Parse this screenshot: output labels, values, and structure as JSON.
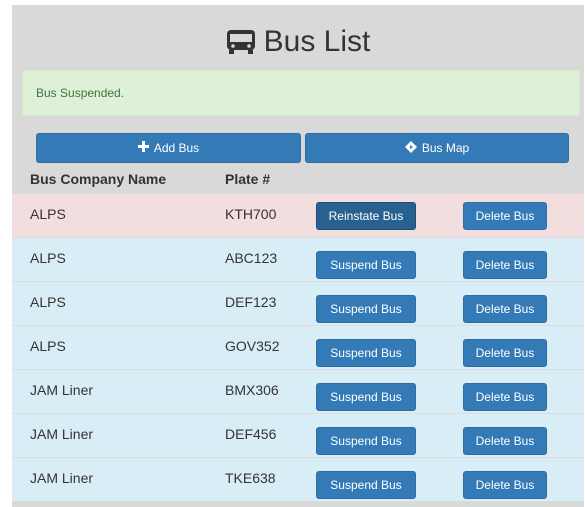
{
  "page": {
    "title": "Bus List",
    "title_icon": "bus-icon"
  },
  "alert": {
    "message": "Bus Suspended."
  },
  "toolbar": {
    "add_label": "Add Bus",
    "add_icon": "plus-icon",
    "map_label": "Bus Map",
    "map_icon": "directions-icon"
  },
  "table": {
    "headers": [
      "Bus Company Name",
      "Plate #"
    ],
    "rows": [
      {
        "company": "ALPS",
        "plate": "KTH700",
        "action": "Reinstate Bus",
        "delete": "Delete Bus",
        "status": "suspended"
      },
      {
        "company": "ALPS",
        "plate": "ABC123",
        "action": "Suspend Bus",
        "delete": "Delete Bus",
        "status": "active"
      },
      {
        "company": "ALPS",
        "plate": "DEF123",
        "action": "Suspend Bus",
        "delete": "Delete Bus",
        "status": "active"
      },
      {
        "company": "ALPS",
        "plate": "GOV352",
        "action": "Suspend Bus",
        "delete": "Delete Bus",
        "status": "active"
      },
      {
        "company": "JAM Liner",
        "plate": "BMX306",
        "action": "Suspend Bus",
        "delete": "Delete Bus",
        "status": "active"
      },
      {
        "company": "JAM Liner",
        "plate": "DEF456",
        "action": "Suspend Bus",
        "delete": "Delete Bus",
        "status": "active"
      },
      {
        "company": "JAM Liner",
        "plate": "TKE638",
        "action": "Suspend Bus",
        "delete": "Delete Bus",
        "status": "active"
      }
    ]
  },
  "colors": {
    "primary": "#337ab7",
    "success_bg": "#dff0d8",
    "success_text": "#3c763d",
    "danger_row": "#f2dede",
    "info_row": "#d9edf7",
    "panel_bg": "#d9d9d9"
  }
}
